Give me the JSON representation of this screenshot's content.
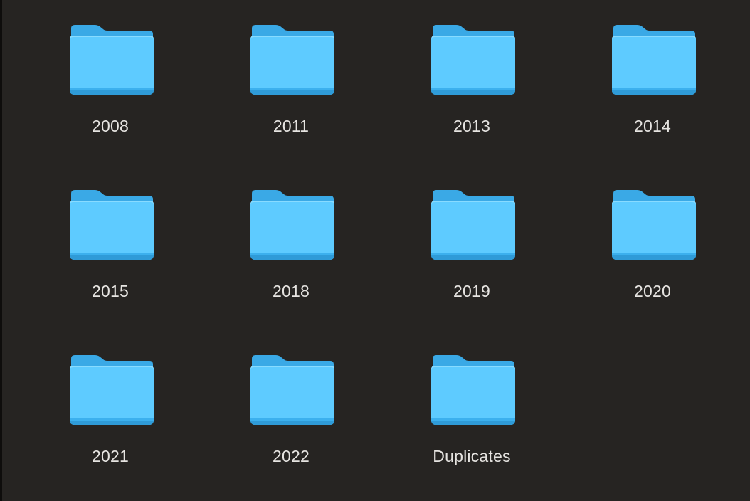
{
  "colors": {
    "background": "#262422",
    "folder_back": "#39a9e6",
    "folder_front": "#5ecbff",
    "folder_bottom": "#3cb0ee",
    "label": "#e6e4e1"
  },
  "icon": "folder-icon",
  "folders": [
    {
      "name": "2008"
    },
    {
      "name": "2011"
    },
    {
      "name": "2013"
    },
    {
      "name": "2014"
    },
    {
      "name": "2015"
    },
    {
      "name": "2018"
    },
    {
      "name": "2019"
    },
    {
      "name": "2020"
    },
    {
      "name": "2021"
    },
    {
      "name": "2022"
    },
    {
      "name": "Duplicates"
    }
  ]
}
